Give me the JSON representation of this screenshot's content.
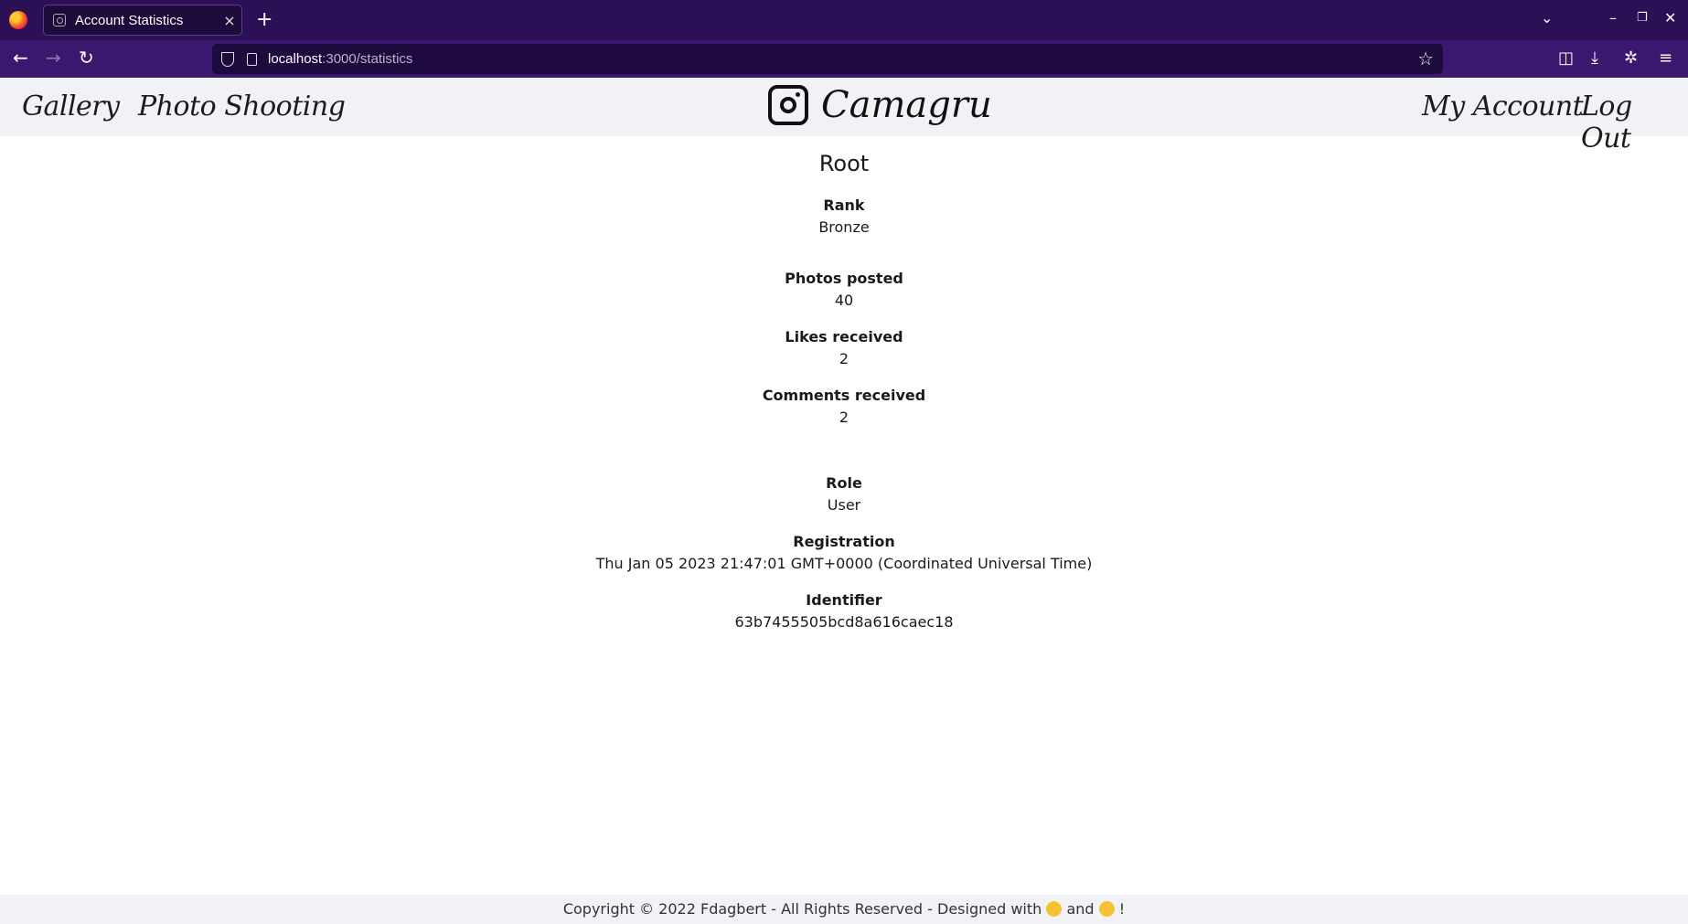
{
  "browser": {
    "tab_title": "Account Statistics",
    "tab_close": "×",
    "new_tab": "+",
    "url_host": "localhost",
    "url_path": ":3000/statistics",
    "colors": {
      "tabbar": "#2b1055",
      "navbar": "#3a1870"
    }
  },
  "header": {
    "links": {
      "gallery": "Gallery",
      "photo_shooting": "Photo Shooting",
      "my_account": "My Account",
      "log_out": "Log Out"
    },
    "brand": "Camagru"
  },
  "profile": {
    "username": "Root",
    "rank_label": "Rank",
    "rank": "Bronze",
    "photos_label": "Photos posted",
    "photos": "40",
    "likes_label": "Likes received",
    "likes": "2",
    "comments_label": "Comments received",
    "comments": "2",
    "role_label": "Role",
    "role": "User",
    "registration_label": "Registration",
    "registration": "Thu Jan 05 2023 21:47:01 GMT+0000 (Coordinated Universal Time)",
    "identifier_label": "Identifier",
    "identifier": "63b7455505bcd8a616caec18"
  },
  "footer": {
    "text_before": "Copyright © 2022 Fdagbert - All Rights Reserved - Designed with",
    "and": "and",
    "end": "!",
    "emoji1": "muscle-emoji",
    "emoji2": "smiling-face-emoji"
  }
}
